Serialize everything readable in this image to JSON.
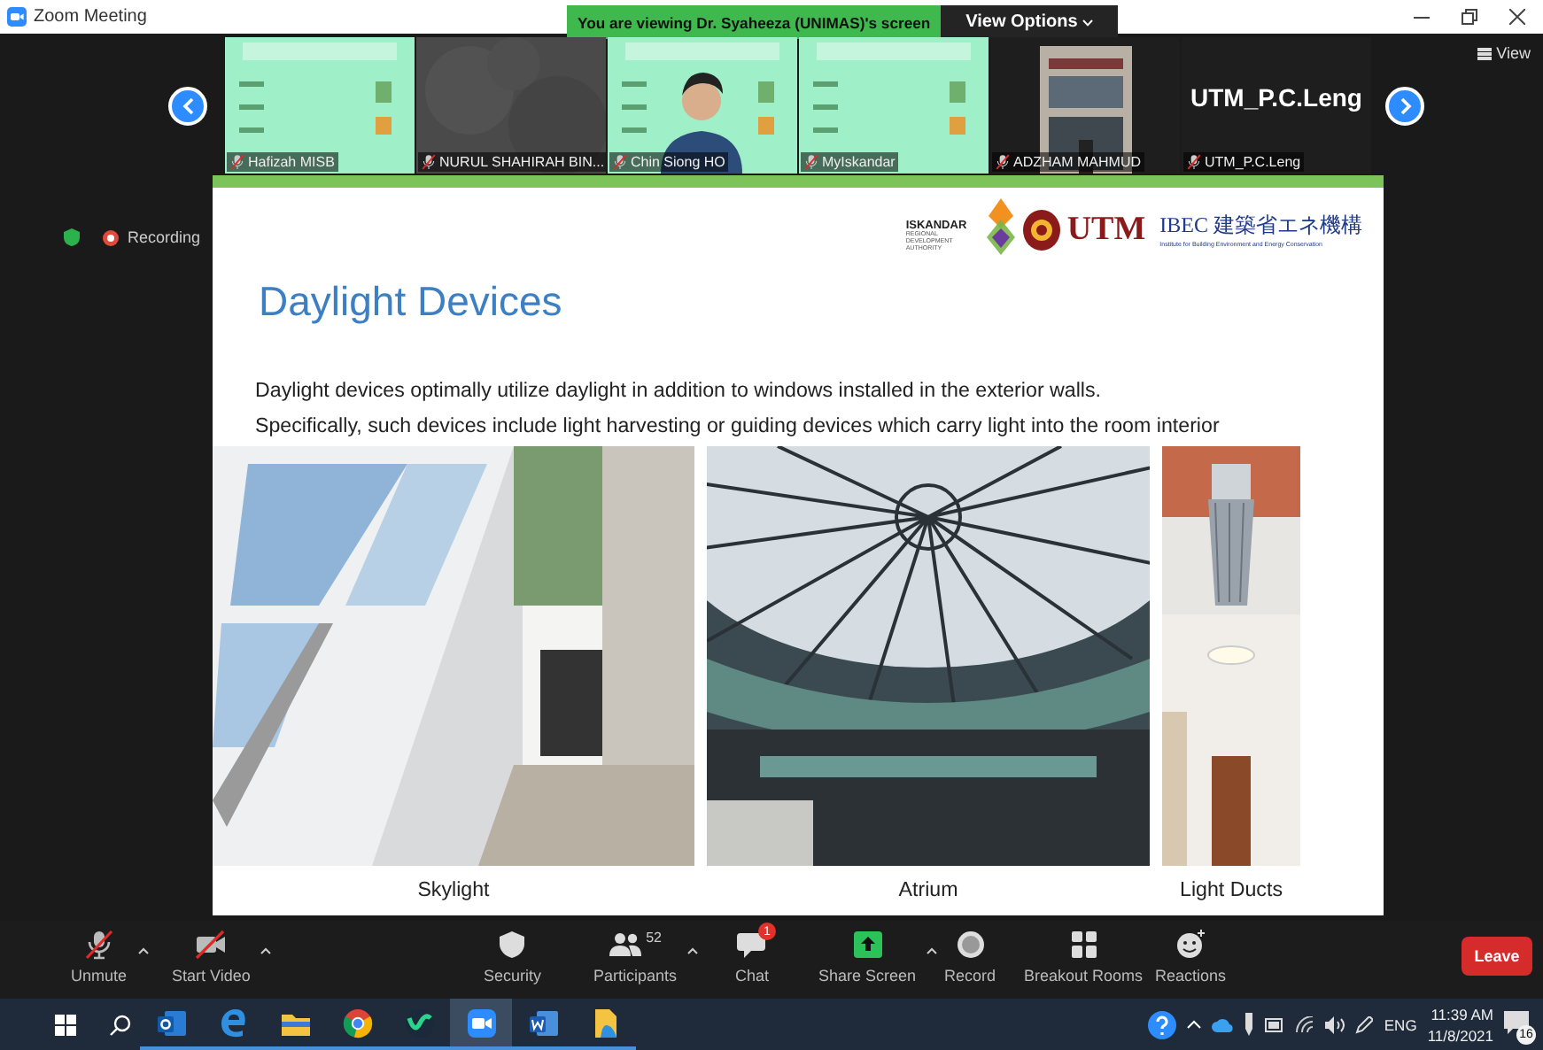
{
  "window": {
    "title": "Zoom Meeting"
  },
  "share_banner": {
    "text": "You are viewing Dr. Syaheeza (UNIMAS)'s screen",
    "view_options": "View Options"
  },
  "view_button": "View",
  "participants_strip": [
    {
      "kind": "picture",
      "name": "Hafizah MISB",
      "muted": true
    },
    {
      "kind": "picture",
      "name": "NURUL SHAHIRAH BIN...",
      "muted": true
    },
    {
      "kind": "picture",
      "name": "Chin Siong HO",
      "muted": true
    },
    {
      "kind": "picture",
      "name": "MyIskandar",
      "muted": true
    },
    {
      "kind": "picture",
      "name": "ADZHAM MAHMUD",
      "muted": true
    },
    {
      "kind": "name",
      "display_name": "UTM_P.C.Leng",
      "name": "UTM_P.C.Leng",
      "muted": true
    }
  ],
  "recording": "Recording",
  "slide": {
    "logos": {
      "iskandar": "ISKANDAR",
      "iskandar_sub": "REGIONAL DEVELOPMENT AUTHORITY",
      "utm": "UTM",
      "ibec": "IBEC 建築省エネ機構",
      "ibec_sub": "Institute for Building Environment and Energy Conservation"
    },
    "title": "Daylight Devices",
    "body": [
      "Daylight devices optimally utilize daylight in addition to windows installed in the exterior walls.",
      "Specifically, such devices include light harvesting or guiding devices which carry light into the room interior"
    ],
    "figures": [
      {
        "kind": "skylight",
        "caption": "Skylight"
      },
      {
        "kind": "atrium",
        "caption": "Atrium"
      },
      {
        "kind": "duct",
        "caption": "Light Ducts"
      }
    ]
  },
  "toolbar": [
    {
      "kind": "mic",
      "label": "Unmute",
      "menu": true
    },
    {
      "kind": "video",
      "label": "Start Video",
      "menu": true
    },
    {
      "kind": "security",
      "label": "Security",
      "menu": false
    },
    {
      "kind": "participants",
      "label": "Participants",
      "count": "52",
      "menu": true
    },
    {
      "kind": "chat",
      "label": "Chat",
      "badge": "1",
      "menu": false
    },
    {
      "kind": "share",
      "label": "Share Screen",
      "menu": true
    },
    {
      "kind": "record",
      "label": "Record",
      "menu": false
    },
    {
      "kind": "breakout",
      "label": "Breakout Rooms",
      "menu": false
    },
    {
      "kind": "reactions",
      "label": "Reactions",
      "menu": false
    }
  ],
  "leave_button": "Leave",
  "taskbar": {
    "apps": [
      {
        "kind": "outlook",
        "active": false
      },
      {
        "kind": "edge",
        "active": false
      },
      {
        "kind": "files",
        "active": false
      },
      {
        "kind": "chrome",
        "active": false
      },
      {
        "kind": "webex",
        "active": false
      },
      {
        "kind": "zoom",
        "active": true
      },
      {
        "kind": "word",
        "active": false
      },
      {
        "kind": "folder",
        "active": false
      }
    ],
    "language": "ENG",
    "time": "11:39 AM",
    "date": "11/8/2021",
    "notifications": "16"
  }
}
